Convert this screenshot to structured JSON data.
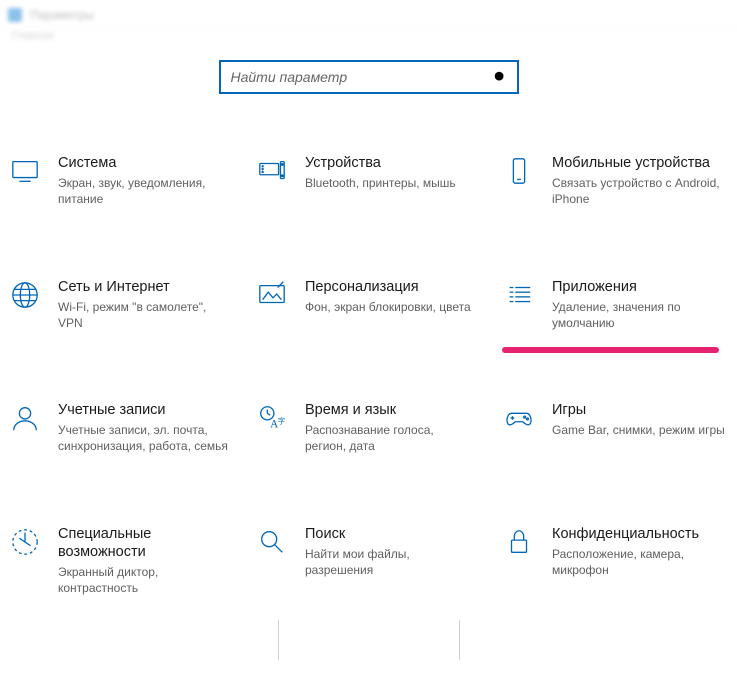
{
  "window": {
    "title": "Параметры"
  },
  "breadcrumb": "Главная",
  "search": {
    "placeholder": "Найти параметр"
  },
  "tiles": [
    {
      "key": "system",
      "title": "Система",
      "desc": "Экран, звук, уведомления, питание"
    },
    {
      "key": "devices",
      "title": "Устройства",
      "desc": "Bluetooth, принтеры, мышь"
    },
    {
      "key": "mobile",
      "title": "Мобильные устройства",
      "desc": "Связать устройство с Android, iPhone"
    },
    {
      "key": "network",
      "title": "Сеть и Интернет",
      "desc": "Wi-Fi, режим \"в самолете\", VPN"
    },
    {
      "key": "personalization",
      "title": "Персонализация",
      "desc": "Фон, экран блокировки, цвета"
    },
    {
      "key": "apps",
      "title": "Приложения",
      "desc": "Удаление, значения по умолчанию",
      "highlight": true
    },
    {
      "key": "accounts",
      "title": "Учетные записи",
      "desc": "Учетные записи, эл. почта, синхронизация, работа, семья"
    },
    {
      "key": "time",
      "title": "Время и язык",
      "desc": "Распознавание голоса, регион, дата"
    },
    {
      "key": "gaming",
      "title": "Игры",
      "desc": "Game Bar, снимки, режим игры"
    },
    {
      "key": "ease",
      "title": "Специальные возможности",
      "desc": "Экранный диктор, контрастность"
    },
    {
      "key": "search-cat",
      "title": "Поиск",
      "desc": "Найти мои файлы, разрешения"
    },
    {
      "key": "privacy",
      "title": "Конфиденциальность",
      "desc": "Расположение, камера, микрофон"
    }
  ],
  "colors": {
    "accent": "#0067b8",
    "highlight": "#e6236f"
  }
}
